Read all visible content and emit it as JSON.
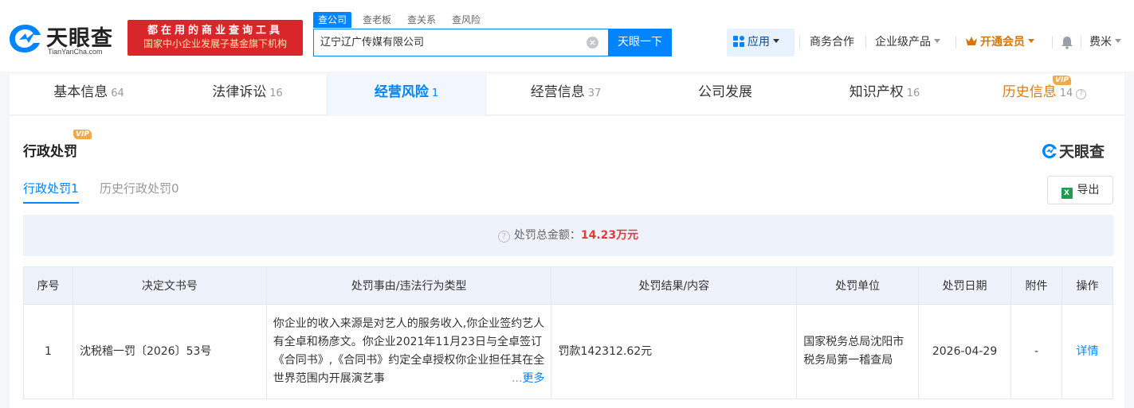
{
  "header": {
    "logo_text": "天眼查",
    "logo_sub": "TianYanCha.com",
    "banner_line1": "都在用的商业查询工具",
    "banner_line2": "国家中小企业发展子基金旗下机构"
  },
  "search": {
    "tabs": [
      "查公司",
      "查老板",
      "查关系",
      "查风险"
    ],
    "value": "辽宁辽广传媒有限公司",
    "button": "天眼一下"
  },
  "nav": {
    "apps": "应用",
    "biz": "商务合作",
    "enterprise": "企业级产品",
    "member": "开通会员",
    "user": "费米"
  },
  "tabs": [
    {
      "label": "基本信息",
      "count": "64"
    },
    {
      "label": "法律诉讼",
      "count": "16"
    },
    {
      "label": "经营风险",
      "count": "1"
    },
    {
      "label": "经营信息",
      "count": "37"
    },
    {
      "label": "公司发展",
      "count": ""
    },
    {
      "label": "知识产权",
      "count": "16"
    },
    {
      "label": "历史信息",
      "count": "14"
    }
  ],
  "vip_badge": "VIP",
  "section": {
    "title": "行政处罚",
    "brand": "天眼查",
    "subtabs": [
      {
        "label": "行政处罚",
        "count": "1"
      },
      {
        "label": "历史行政处罚",
        "count": "0"
      }
    ],
    "export": "导出",
    "summary_label": "处罚总金额：",
    "summary_amount": "14.23万元"
  },
  "table": {
    "headers": [
      "序号",
      "决定文书号",
      "处罚事由/违法行为类型",
      "处罚结果/内容",
      "处罚单位",
      "处罚日期",
      "附件",
      "操作"
    ],
    "rows": [
      {
        "index": "1",
        "doc_no": "沈税稽一罚〔2026〕53号",
        "reason": "你企业的收入来源是对艺人的服务收入,你企业签约艺人有全卓和杨彦文。你企业2021年11月23日与全卓签订《合同书》,《合同书》约定全卓授权你企业担任其在全世界范围内开展演艺事",
        "result": "罚款142312.62元",
        "authority": "国家税务总局沈阳市税务局第一稽查局",
        "date": "2026-04-29",
        "attachment": "-",
        "action": "详情"
      }
    ],
    "more_dots": "...",
    "more_label": "更多"
  }
}
